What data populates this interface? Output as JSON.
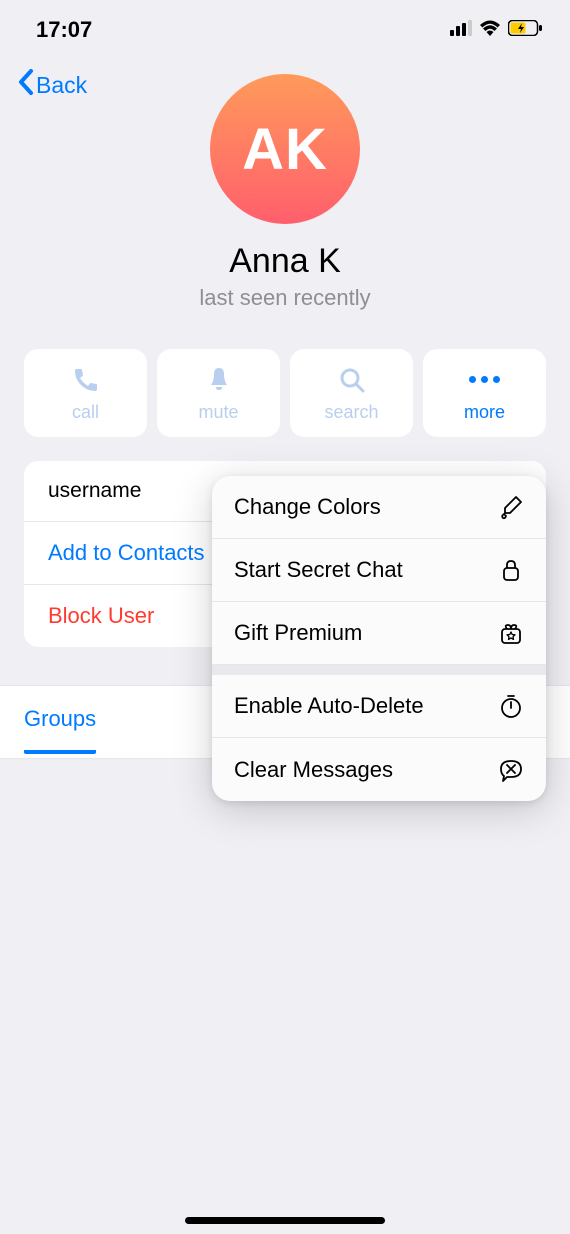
{
  "status_bar": {
    "time": "17:07"
  },
  "header": {
    "back_label": "Back"
  },
  "contact": {
    "initials": "AK",
    "name": "Anna K",
    "status": "last seen recently"
  },
  "actions": {
    "call": "call",
    "mute": "mute",
    "search": "search",
    "more": "more"
  },
  "info": {
    "username_label": "username",
    "add_contacts": "Add to Contacts",
    "block_user": "Block User"
  },
  "tabs": {
    "groups": "Groups"
  },
  "menu": {
    "change_colors": "Change Colors",
    "secret_chat": "Start Secret Chat",
    "gift_premium": "Gift Premium",
    "auto_delete": "Enable Auto-Delete",
    "clear_messages": "Clear Messages"
  }
}
